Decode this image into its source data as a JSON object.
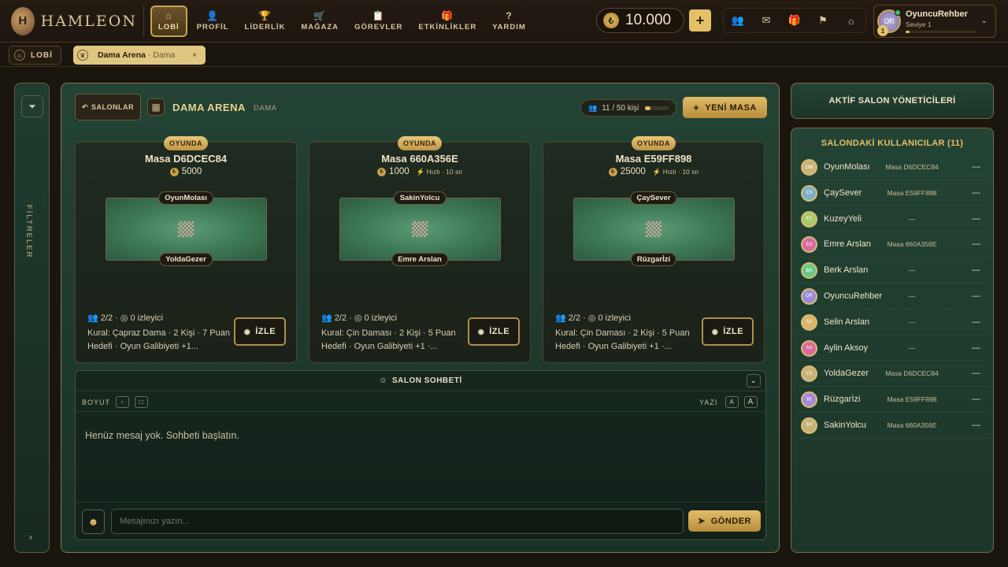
{
  "brand": {
    "name": "HAMLEON",
    "initials": "H"
  },
  "nav": [
    {
      "label": "LOBİ",
      "icon": "⌂",
      "active": true
    },
    {
      "label": "PROFİL",
      "icon": "👤"
    },
    {
      "label": "LİDERLİK",
      "icon": "🏆"
    },
    {
      "label": "MAĞAZA",
      "icon": "🛒"
    },
    {
      "label": "GÖREVLER",
      "icon": "📋"
    },
    {
      "label": "ETKİNLİKLER",
      "icon": "🎁"
    },
    {
      "label": "YARDIM",
      "icon": "?"
    }
  ],
  "wallet": {
    "balance": "10.000",
    "add_label": "+"
  },
  "user": {
    "name": "OyuncuRehber",
    "level_text": "Seviye 1",
    "initials": "OR",
    "level": "1",
    "xp_progress": 0.05
  },
  "tabs": {
    "lobby_label": "LOBİ",
    "arena_label": "Dama Arena",
    "arena_sub": "· Dama",
    "close": "×"
  },
  "sidebar": {
    "filters_label": "FİLTRELER",
    "expand": "›"
  },
  "arena": {
    "back_label": "SALONLAR",
    "title": "DAMA ARENA",
    "game": "DAMA",
    "occupancy": "11 / 50 kişi",
    "occupancy_fraction": 0.22,
    "new_table_label": "YENİ MASA"
  },
  "tables": [
    {
      "status": "OYUNDA",
      "name": "Masa D6DCEC84",
      "stake": "5000",
      "speed": "",
      "player_top": "OyunMolası",
      "player_bottom": "YoldaGezer",
      "stats": "2/2 · ◎ 0 izleyici",
      "rules": "Kural: Çapraz Dama · 2 Kişi · 7 Puan Hedefi · Oyun Galibiyeti +1...",
      "watch_label": "İZLE"
    },
    {
      "status": "OYUNDA",
      "name": "Masa 660A356E",
      "stake": "1000",
      "speed": "Hızlı · 10 sn",
      "player_top": "SakinYolcu",
      "player_bottom": "Emre Arslan",
      "stats": "2/2 · ◎ 0 izleyici",
      "rules": "Kural: Çin Daması · 2 Kişi · 5 Puan Hedefi · Oyun Galibiyeti +1 ·...",
      "watch_label": "İZLE"
    },
    {
      "status": "OYUNDA",
      "name": "Masa E59FF898",
      "stake": "25000",
      "speed": "Hızlı · 10 sn",
      "player_top": "ÇaySever",
      "player_bottom": "Rüzgarİzi",
      "stats": "2/2 · ◎ 0 izleyici",
      "rules": "Kural: Çin Daması · 2 Kişi · 5 Puan Hedefi · Oyun Galibiyeti +1 ·...",
      "watch_label": "İZLE"
    }
  ],
  "chat": {
    "title": "SALON SOHBETİ",
    "size_label": "BOYUT",
    "text_label": "YAZI",
    "text_small": "A",
    "text_large": "A",
    "empty_text": "Henüz mesaj yok. Sohbeti başlatın.",
    "input_placeholder": "Mesajınızı yazın...",
    "send_label": "GÖNDER"
  },
  "admins": {
    "title": "AKTİF SALON YÖNETİCİLERİ"
  },
  "users": {
    "title": "SALONDAKİ KULLANICILAR (11)",
    "list": [
      {
        "name": "OyunMolası",
        "initials": "OM",
        "table": "Masa D6DCEC84",
        "color": "#c9b27a"
      },
      {
        "name": "ÇaySever",
        "initials": "ÇS",
        "table": "Masa E59FF898",
        "color": "#7ab0c9"
      },
      {
        "name": "KuzeyYeli",
        "initials": "KY",
        "table": "—",
        "color": "#a8c96a"
      },
      {
        "name": "Emre Arslan",
        "initials": "EA",
        "table": "Masa 660A356E",
        "color": "#d96aa0"
      },
      {
        "name": "Berk Arslan",
        "initials": "BA",
        "table": "—",
        "color": "#6ac98a"
      },
      {
        "name": "OyuncuRehber",
        "initials": "OR",
        "table": "—",
        "color": "#9a8ad9"
      },
      {
        "name": "Selin Arslan",
        "initials": "SA",
        "table": "—",
        "color": "#d9b46a"
      },
      {
        "name": "Aylin Aksoy",
        "initials": "AA",
        "table": "—",
        "color": "#d96a9a"
      },
      {
        "name": "YoldaGezer",
        "initials": "YG",
        "table": "Masa D6DCEC84",
        "color": "#c9b27a"
      },
      {
        "name": "Rüzgarİzi",
        "initials": "Rİ",
        "table": "Masa E59FF898",
        "color": "#a88ad9"
      },
      {
        "name": "SakinYolcu",
        "initials": "SY",
        "table": "Masa 660A356E",
        "color": "#c9b27a"
      }
    ]
  }
}
